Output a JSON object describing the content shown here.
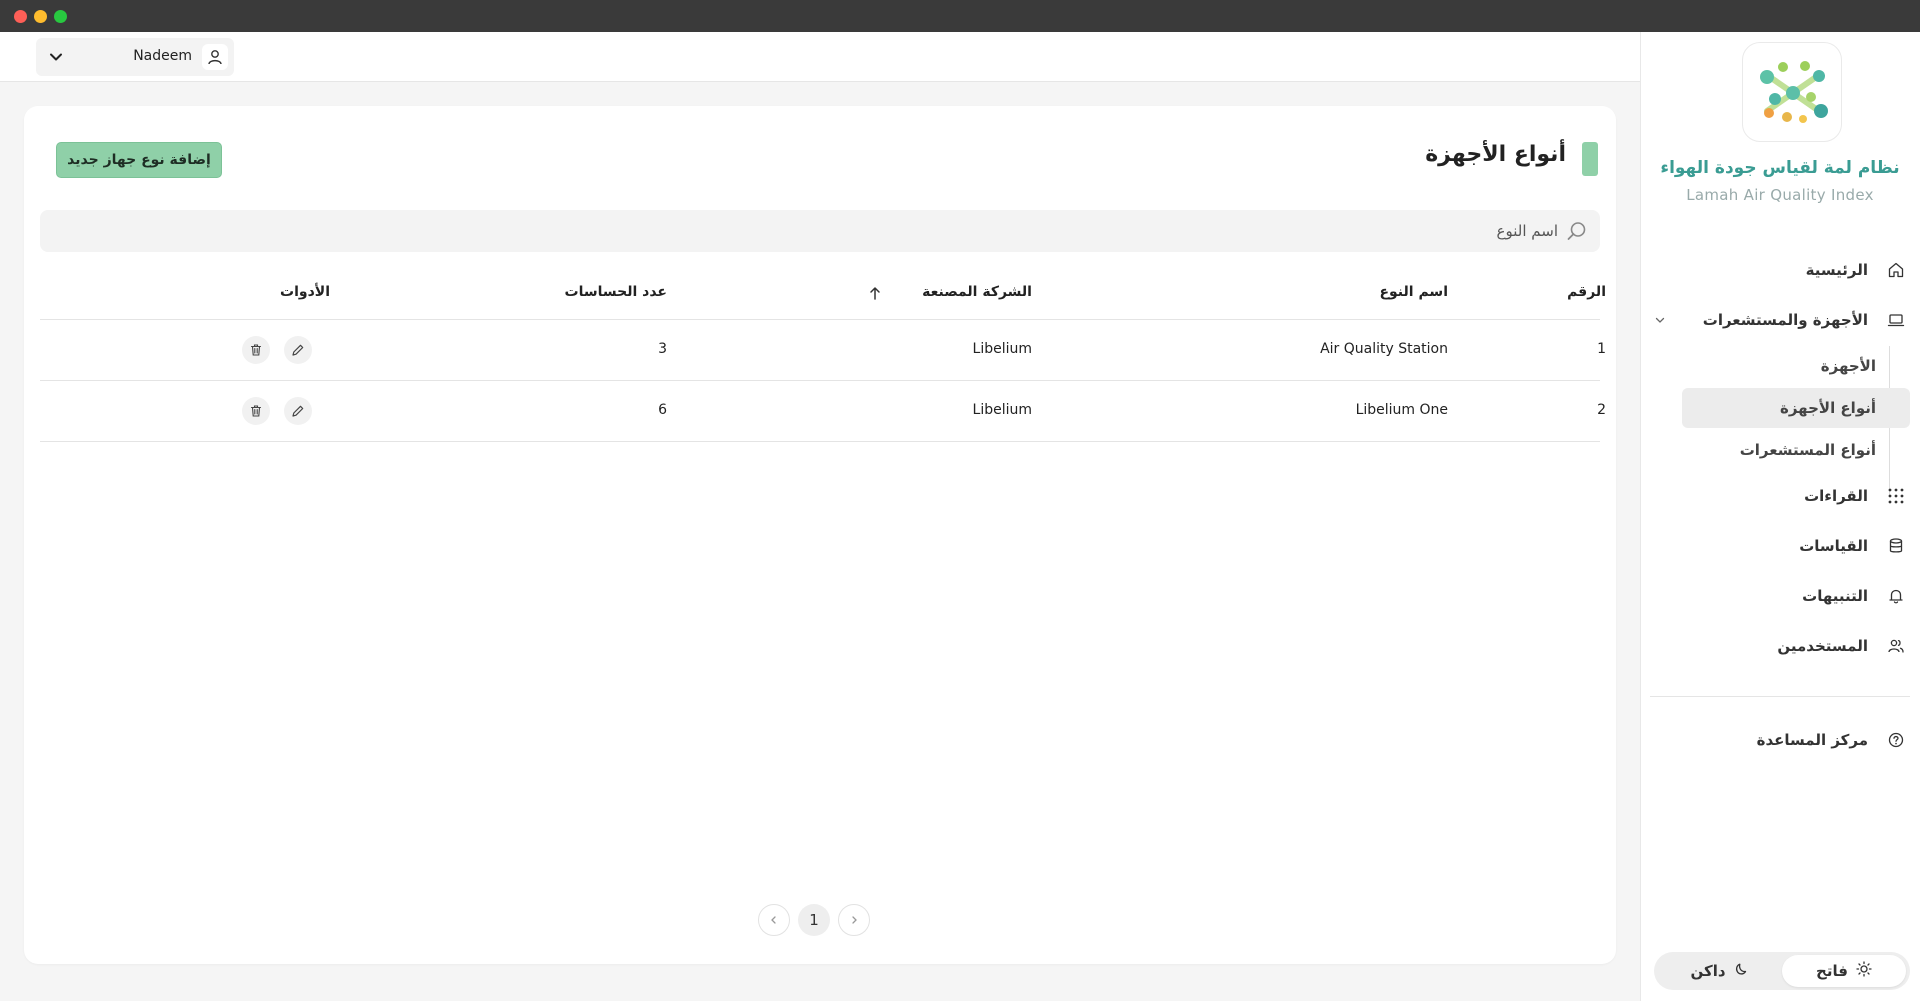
{
  "app": {
    "title": "نظام لمة لقياس جودة الهواء",
    "subtitle": "Lamah Air Quality Index"
  },
  "user": {
    "name": "Nadeem"
  },
  "sidebar": {
    "items": [
      {
        "label": "الرئيسية",
        "icon": "home-icon"
      },
      {
        "label": "الأجهزة والمستشعرات",
        "icon": "laptop-icon",
        "expanded": true
      },
      {
        "label": "القراءات",
        "icon": "grid-icon"
      },
      {
        "label": "القياسات",
        "icon": "database-icon"
      },
      {
        "label": "التنبيهات",
        "icon": "bell-icon"
      },
      {
        "label": "المستخدمين",
        "icon": "users-icon"
      }
    ],
    "subitems": [
      {
        "label": "الأجهزة"
      },
      {
        "label": "أنواع الأجهزة",
        "active": true
      },
      {
        "label": "أنواع المستشعرات"
      }
    ],
    "help": {
      "label": "مركز المساعدة",
      "icon": "help-icon"
    },
    "theme": {
      "light_label": "فاتح",
      "dark_label": "داكن",
      "selected": "light"
    }
  },
  "page": {
    "title": "أنواع الأجهزة",
    "add_button": "إضافة نوع جهاز جديد",
    "search": {
      "placeholder": "اسم النوع",
      "value": ""
    },
    "accent_color": "#8fd0a8"
  },
  "table": {
    "columns": [
      "الرقم",
      "اسم النوع",
      "الشركة المصنعة",
      "عدد الحساسات",
      "الأدوات"
    ],
    "sort": {
      "column": "الشركة المصنعة",
      "direction": "ascending"
    },
    "rows": [
      {
        "number": "1",
        "type_name": "Air Quality Station",
        "manufacturer": "Libelium",
        "sensor_count": "3"
      },
      {
        "number": "2",
        "type_name": "Libelium One",
        "manufacturer": "Libelium",
        "sensor_count": "6"
      }
    ]
  },
  "pagination": {
    "current": "1"
  }
}
